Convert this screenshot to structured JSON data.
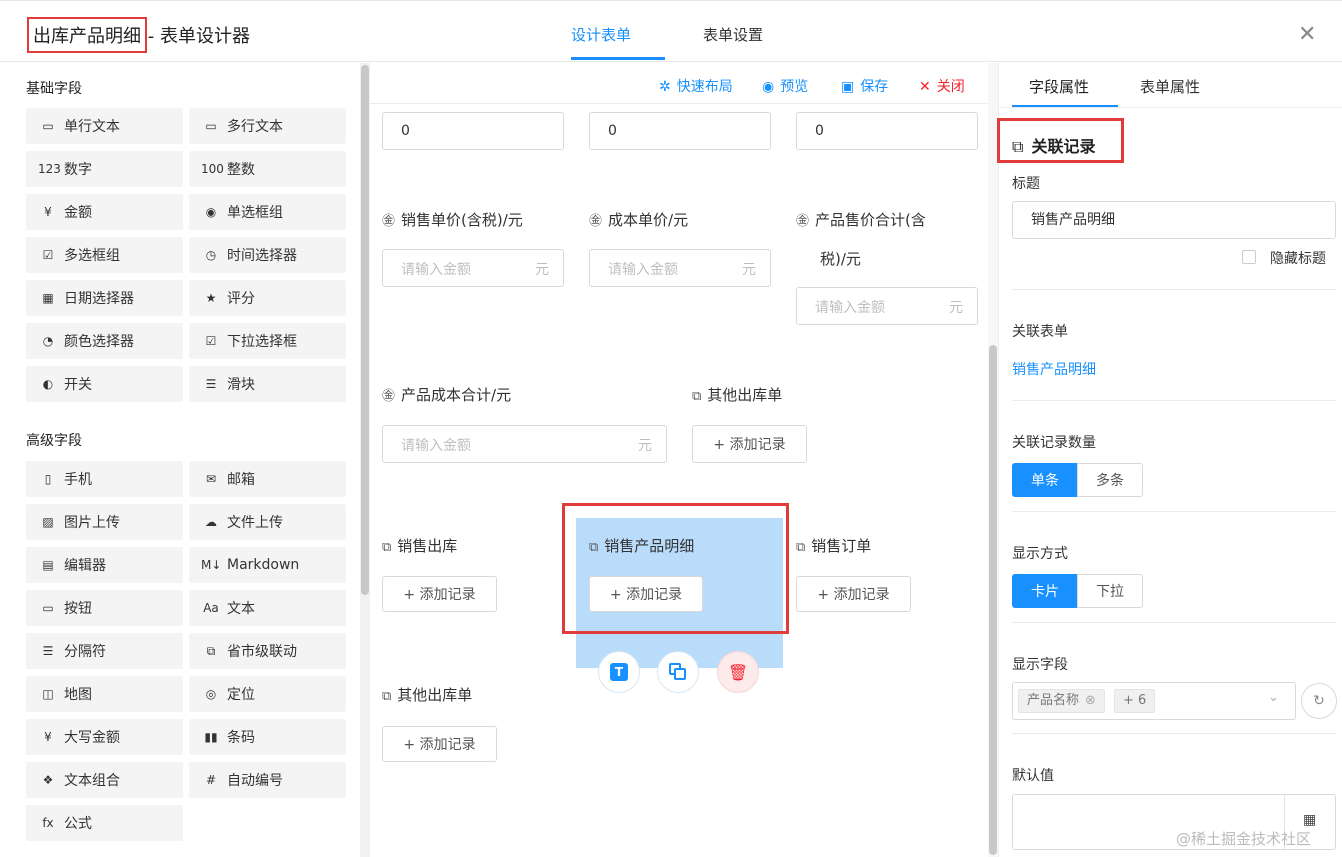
{
  "header": {
    "title_name": "出库产品明细",
    "title_suffix": " - 表单设计器",
    "tabs": [
      "设计表单",
      "表单设置"
    ]
  },
  "left": {
    "basic_title": "基础字段",
    "basic_fields": [
      {
        "label": "单行文本",
        "icon": "▭"
      },
      {
        "label": "多行文本",
        "icon": "▭"
      },
      {
        "label": "数字",
        "icon": "123"
      },
      {
        "label": "整数",
        "icon": "100"
      },
      {
        "label": "金额",
        "icon": "¥"
      },
      {
        "label": "单选框组",
        "icon": "◉"
      },
      {
        "label": "多选框组",
        "icon": "☑"
      },
      {
        "label": "时间选择器",
        "icon": "◷"
      },
      {
        "label": "日期选择器",
        "icon": "▦"
      },
      {
        "label": "评分",
        "icon": "★"
      },
      {
        "label": "颜色选择器",
        "icon": "◔"
      },
      {
        "label": "下拉选择框",
        "icon": "☑"
      },
      {
        "label": "开关",
        "icon": "◐"
      },
      {
        "label": "滑块",
        "icon": "☰"
      }
    ],
    "advanced_title": "高级字段",
    "advanced_fields": [
      {
        "label": "手机",
        "icon": "▯"
      },
      {
        "label": "邮箱",
        "icon": "✉"
      },
      {
        "label": "图片上传",
        "icon": "▨"
      },
      {
        "label": "文件上传",
        "icon": "☁"
      },
      {
        "label": "编辑器",
        "icon": "▤"
      },
      {
        "label": "Markdown",
        "icon": "M↓"
      },
      {
        "label": "按钮",
        "icon": "▭"
      },
      {
        "label": "文本",
        "icon": "Aa"
      },
      {
        "label": "分隔符",
        "icon": "☰"
      },
      {
        "label": "省市级联动",
        "icon": "⧉"
      },
      {
        "label": "地图",
        "icon": "◫"
      },
      {
        "label": "定位",
        "icon": "◎"
      },
      {
        "label": "大写金额",
        "icon": "¥"
      },
      {
        "label": "条码",
        "icon": "▮▮"
      },
      {
        "label": "文本组合",
        "icon": "❖"
      },
      {
        "label": "自动编号",
        "icon": "#"
      },
      {
        "label": "公式",
        "icon": "fx"
      }
    ]
  },
  "toolbar": {
    "quick_layout": "快速布局",
    "preview": "预览",
    "save": "保存",
    "close": "关闭"
  },
  "canvas": {
    "number_values": [
      "0",
      "0",
      "0"
    ],
    "money_fields": [
      {
        "label": "销售单价(含税)/元",
        "placeholder": "请输入金额",
        "unit": "元"
      },
      {
        "label": "成本单价/元",
        "placeholder": "请输入金额",
        "unit": "元"
      },
      {
        "label_line1": "产品售价合计(含",
        "label_line2": "税)/元",
        "placeholder": "请输入金额",
        "unit": "元"
      },
      {
        "label": "产品成本合计/元",
        "placeholder": "请输入金额",
        "unit": "元"
      }
    ],
    "relation_fields": [
      {
        "label": "其他出库单",
        "button": "+ 添加记录"
      },
      {
        "label": "销售出库",
        "button": "+ 添加记录"
      },
      {
        "label": "销售产品明细",
        "button": "+ 添加记录"
      },
      {
        "label": "销售订单",
        "button": "+ 添加记录"
      },
      {
        "label": "其他出库单",
        "button": "+ 添加记录"
      }
    ]
  },
  "right": {
    "tabs": [
      "字段属性",
      "表单属性"
    ],
    "component_title": "关联记录",
    "title_label": "标题",
    "title_value": "销售产品明细",
    "hide_title": "隐藏标题",
    "related_form_label": "关联表单",
    "related_form_value": "销售产品明细",
    "record_count_label": "关联记录数量",
    "record_count_options": [
      "单条",
      "多条"
    ],
    "display_mode_label": "显示方式",
    "display_mode_options": [
      "卡片",
      "下拉"
    ],
    "display_fields_label": "显示字段",
    "display_fields_tag": "产品名称",
    "display_fields_more": "+ 6",
    "default_value_label": "默认值"
  },
  "watermark": "@稀土掘金技术社区",
  "colors": {
    "accent": "#1890ff",
    "highlight": "#e03c3c",
    "selected": "#b9dcfb",
    "delete": "#f5222d"
  }
}
